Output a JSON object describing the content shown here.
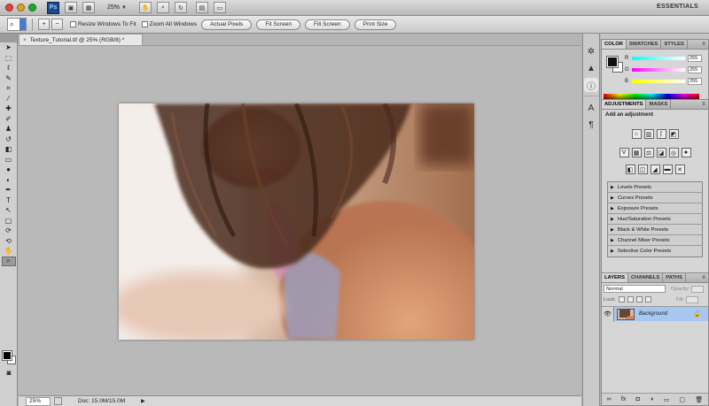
{
  "appbar": {
    "app_icon": "Ps",
    "zoom": "25%",
    "workspace": "ESSENTIALS",
    "traffic_colors": [
      "#e0443e",
      "#dea123",
      "#1aab29"
    ]
  },
  "options": {
    "resize_windows": "Resize Windows To Fit",
    "zoom_all": "Zoom All Windows",
    "actual_pixels": "Actual Pixels",
    "fit_screen": "Fit Screen",
    "fill_screen": "Fill Screen",
    "print_size": "Print Size"
  },
  "document": {
    "tab_title": "Texture_Tutorial.tif @ 25% (RGB/8) *",
    "close": "×"
  },
  "status": {
    "zoom": "25%",
    "doc": "Doc: 15.0M/15.0M"
  },
  "color_panel": {
    "tabs": [
      "COLOR",
      "SWATCHES",
      "STYLES"
    ],
    "r_label": "R",
    "g_label": "G",
    "b_label": "B",
    "r_value": "255",
    "g_value": "255",
    "b_value": "255"
  },
  "adjustments_panel": {
    "tabs": [
      "ADJUSTMENTS",
      "MASKS"
    ],
    "title": "Add an adjustment",
    "presets": [
      "Levels Presets",
      "Curves Presets",
      "Exposure Presets",
      "Hue/Saturation Presets",
      "Black & White Presets",
      "Channel Mixer Presets",
      "Selective Color Presets"
    ]
  },
  "layers_panel": {
    "tabs": [
      "LAYERS",
      "CHANNELS",
      "PATHS"
    ],
    "blend_mode": "Normal",
    "opacity_label": "Opacity:",
    "lock_label": "Lock:",
    "fill_label": "Fill:",
    "layer_name": "Background"
  }
}
